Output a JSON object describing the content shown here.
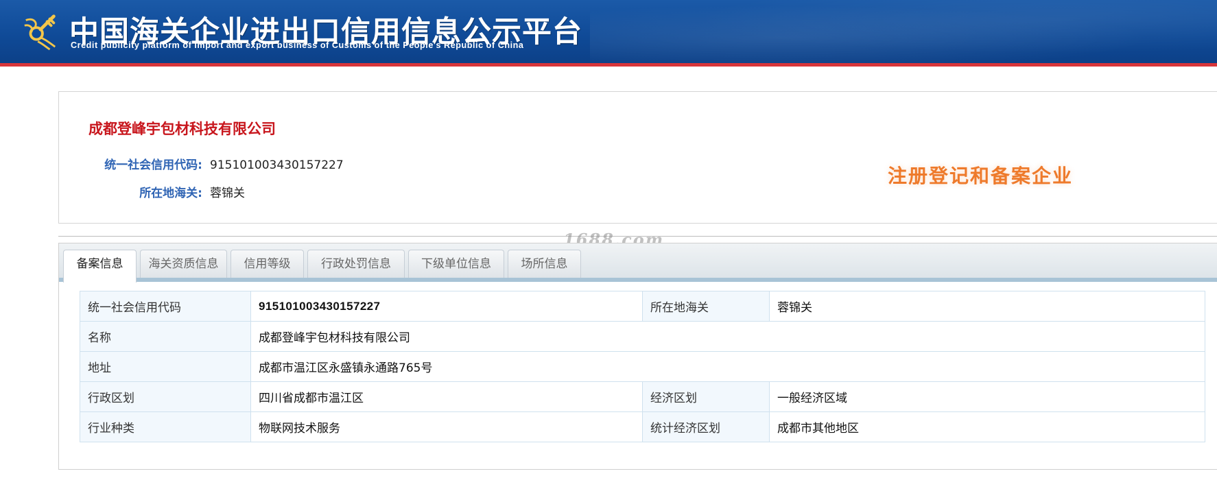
{
  "header": {
    "title": "中国海关企业进出口信用信息公示平台",
    "subtitle": "Credit publicity platform of import and export business of Customs of the People's Republic of China",
    "emblem_icon": "customs-emblem-icon",
    "colors": {
      "background": "#0f4a97",
      "accent_bar": "#d8353a"
    }
  },
  "company": {
    "name": "成都登峰宇包材科技有限公司",
    "credit_code_label": "统一社会信用代码:",
    "credit_code": "915101003430157227",
    "customs_label": "所在地海关:",
    "customs": "蓉锦关",
    "status": "注册登记和备案企业",
    "colors": {
      "name": "#c8161d",
      "label": "#2f64b4",
      "status": "#ee7a2b"
    }
  },
  "watermark": "1688.com",
  "tabs": [
    {
      "label": "备案信息",
      "active": true
    },
    {
      "label": "海关资质信息",
      "active": false
    },
    {
      "label": "信用等级",
      "active": false
    },
    {
      "label": "行政处罚信息",
      "active": false
    },
    {
      "label": "下级单位信息",
      "active": false
    },
    {
      "label": "场所信息",
      "active": false
    }
  ],
  "record": {
    "credit_code_label": "统一社会信用代码",
    "credit_code": "915101003430157227",
    "customs_label": "所在地海关",
    "customs": "蓉锦关",
    "name_label": "名称",
    "name": "成都登峰宇包材科技有限公司",
    "address_label": "地址",
    "address": "成都市温江区永盛镇永通路765号",
    "admin_region_label": "行政区划",
    "admin_region": "四川省成都市温江区",
    "economic_region_label": "经济区划",
    "economic_region": "一般经济区域",
    "industry_label": "行业种类",
    "industry": "物联网技术服务",
    "stat_region_label": "统计经济区划",
    "stat_region": "成都市其他地区"
  }
}
